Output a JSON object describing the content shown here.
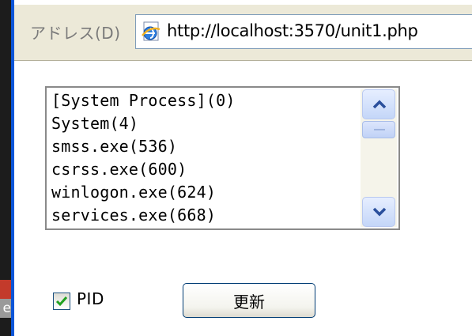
{
  "address_bar": {
    "label": "アドレス(D)",
    "url": "http://localhost:3570/unit1.php",
    "icon": "ie-page-icon"
  },
  "side_fragment": {
    "text": "e"
  },
  "process_list": {
    "items": [
      "[System Process](0)",
      "System(4)",
      "smss.exe(536)",
      "csrss.exe(600)",
      "winlogon.exe(624)",
      "services.exe(668)"
    ],
    "scroll_up_icon": "chevron-up-icon",
    "scroll_down_icon": "chevron-down-icon"
  },
  "pid_checkbox": {
    "label": "PID",
    "checked": true
  },
  "update_button": {
    "label": "更新"
  },
  "colors": {
    "window_border": "#0a55d8",
    "address_bar_bg": "#ece9d8",
    "button_border": "#003c74",
    "checkmark": "#21a121"
  }
}
